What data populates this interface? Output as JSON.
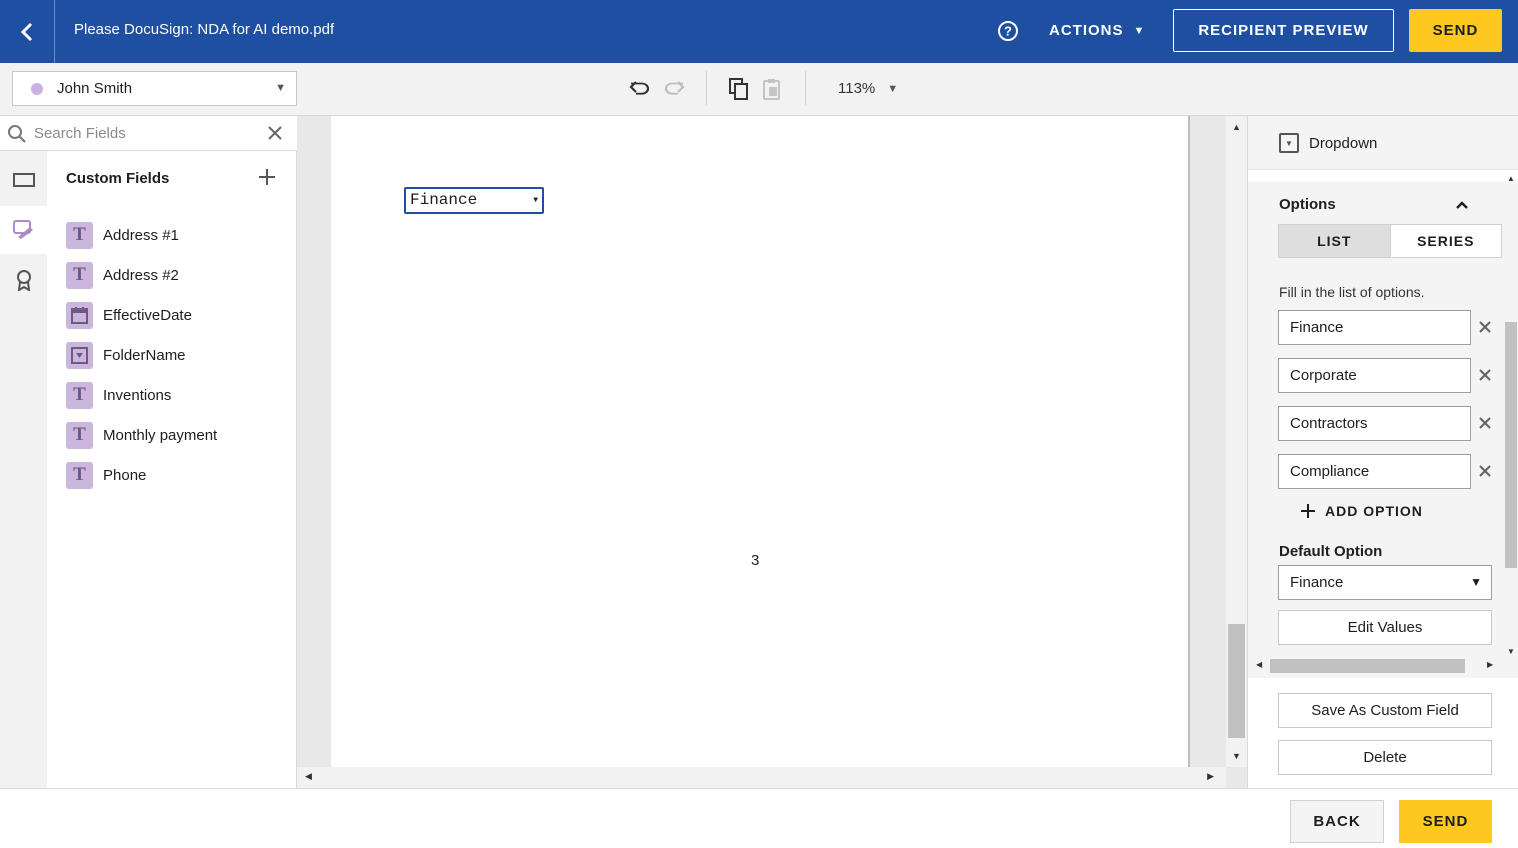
{
  "header": {
    "title": "Please DocuSign: NDA for AI demo.pdf",
    "actions_label": "ACTIONS",
    "recipient_preview_label": "RECIPIENT PREVIEW",
    "send_label": "SEND",
    "background_color": "#1e4fa1",
    "send_color": "#ffc820"
  },
  "toolbar": {
    "recipient": "John Smith",
    "recipient_color": "#c9b3de",
    "zoom": "113%"
  },
  "search": {
    "placeholder": "Search Fields"
  },
  "custom_fields": {
    "title": "Custom Fields",
    "items": [
      {
        "label": "Address #1",
        "icon": "text-icon"
      },
      {
        "label": "Address #2",
        "icon": "text-icon"
      },
      {
        "label": "EffectiveDate",
        "icon": "calendar-icon"
      },
      {
        "label": "FolderName",
        "icon": "dropdown-icon"
      },
      {
        "label": "Inventions",
        "icon": "text-icon"
      },
      {
        "label": "Monthly payment",
        "icon": "text-icon"
      },
      {
        "label": "Phone",
        "icon": "text-icon"
      }
    ]
  },
  "document": {
    "dropdown_value": "Finance",
    "page_number": "3"
  },
  "properties": {
    "field_type": "Dropdown",
    "options_title": "Options",
    "tabs": [
      "LIST",
      "SERIES"
    ],
    "active_tab": "LIST",
    "hint": "Fill in the list of options.",
    "options": [
      "Finance",
      "Corporate",
      "Contractors",
      "Compliance"
    ],
    "add_option_label": "ADD OPTION",
    "default_option_title": "Default Option",
    "default_option_value": "Finance",
    "edit_values_label": "Edit Values",
    "save_custom_field_label": "Save As Custom Field",
    "delete_label": "Delete"
  },
  "footer": {
    "back_label": "BACK",
    "send_label": "SEND"
  }
}
